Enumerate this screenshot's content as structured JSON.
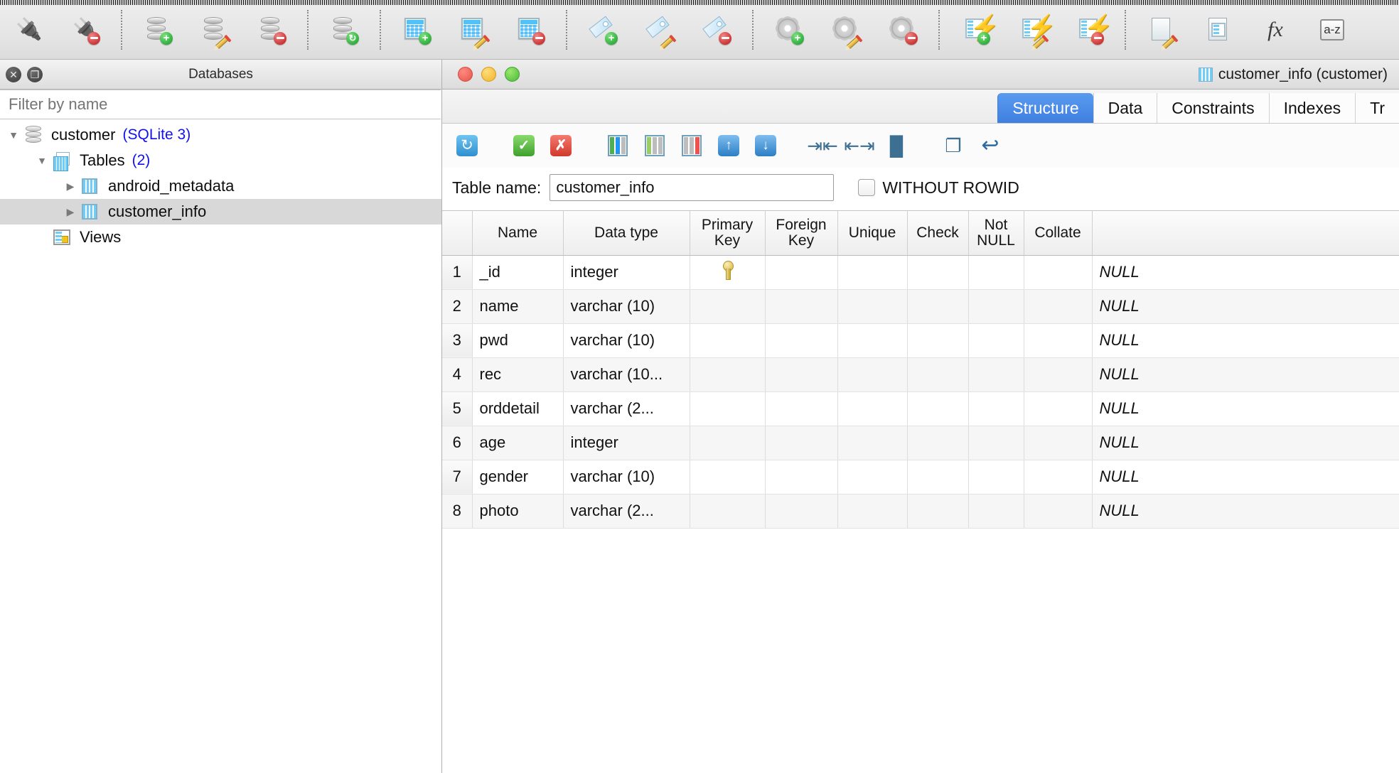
{
  "toolbar": {
    "groups": [
      {
        "name": "connection",
        "items": [
          {
            "name": "connect-database-icon",
            "glyph": "plug"
          },
          {
            "name": "disconnect-database-icon",
            "glyph": "plug-off"
          }
        ]
      },
      {
        "name": "database-crud",
        "items": [
          {
            "name": "add-database-icon",
            "glyph": "db-add"
          },
          {
            "name": "edit-database-icon",
            "glyph": "db-edit"
          },
          {
            "name": "delete-database-icon",
            "glyph": "db-delete"
          }
        ]
      },
      {
        "name": "refresh-group",
        "items": [
          {
            "name": "refresh-database-icon",
            "glyph": "db-refresh"
          }
        ]
      },
      {
        "name": "table-crud",
        "items": [
          {
            "name": "add-table-icon",
            "glyph": "table-add"
          },
          {
            "name": "edit-table-icon",
            "glyph": "table-edit"
          },
          {
            "name": "delete-table-icon",
            "glyph": "table-delete"
          }
        ]
      },
      {
        "name": "index-crud",
        "items": [
          {
            "name": "add-index-icon",
            "glyph": "tag-add"
          },
          {
            "name": "edit-index-icon",
            "glyph": "tag-edit"
          },
          {
            "name": "delete-index-icon",
            "glyph": "tag-delete"
          }
        ]
      },
      {
        "name": "procedure-crud",
        "items": [
          {
            "name": "add-procedure-icon",
            "glyph": "gear-add"
          },
          {
            "name": "edit-procedure-icon",
            "glyph": "gear-edit"
          },
          {
            "name": "delete-procedure-icon",
            "glyph": "gear-delete"
          }
        ]
      },
      {
        "name": "trigger-crud",
        "items": [
          {
            "name": "add-trigger-icon",
            "glyph": "bolt-add"
          },
          {
            "name": "edit-trigger-icon",
            "glyph": "bolt-edit"
          },
          {
            "name": "delete-trigger-icon",
            "glyph": "bolt-delete"
          }
        ]
      },
      {
        "name": "utilities",
        "items": [
          {
            "name": "new-query-icon",
            "glyph": "doc-edit"
          },
          {
            "name": "import-export-icon",
            "glyph": "doc-table"
          },
          {
            "name": "function-builder-icon",
            "glyph": "fx"
          },
          {
            "name": "sort-az-icon",
            "glyph": "az"
          }
        ]
      }
    ],
    "fx_label": "fx",
    "az_label": "a-z"
  },
  "sidebar": {
    "title": "Databases",
    "close_button": "✕",
    "restore_button": "❐",
    "filter": {
      "placeholder": "Filter by name",
      "value": ""
    },
    "tree": [
      {
        "label": "customer",
        "sub": "(SQLite 3)",
        "icon": "database-icon",
        "indent": 0,
        "twisty": "expanded",
        "selected": false
      },
      {
        "label": "Tables",
        "sub": "(2)",
        "icon": "tables-icon",
        "indent": 1,
        "twisty": "expanded",
        "selected": false
      },
      {
        "label": "android_metadata",
        "sub": "",
        "icon": "table-icon",
        "indent": 2,
        "twisty": "collapsed",
        "selected": false
      },
      {
        "label": "customer_info",
        "sub": "",
        "icon": "table-icon",
        "indent": 2,
        "twisty": "collapsed",
        "selected": true
      },
      {
        "label": "Views",
        "sub": "",
        "icon": "views-icon",
        "indent": 1,
        "twisty": "none",
        "selected": false
      }
    ]
  },
  "pane": {
    "title": "customer_info (customer)",
    "window_buttons": [
      "close",
      "minimize",
      "zoom"
    ],
    "tabs": [
      {
        "label": "Structure",
        "active": true
      },
      {
        "label": "Data",
        "active": false
      },
      {
        "label": "Constraints",
        "active": false
      },
      {
        "label": "Indexes",
        "active": false
      },
      {
        "label": "Tr",
        "active": false
      }
    ],
    "structure_toolbar": [
      {
        "name": "refresh-button",
        "glyph": "refresh"
      },
      {
        "name": "apply-button",
        "glyph": "check"
      },
      {
        "name": "discard-button",
        "glyph": "cross"
      },
      {
        "name": "add-field-button",
        "glyph": "col-add"
      },
      {
        "name": "insert-field-button",
        "glyph": "col-insert"
      },
      {
        "name": "delete-field-button",
        "glyph": "col-delete"
      },
      {
        "name": "move-field-up-button",
        "glyph": "arrow-up"
      },
      {
        "name": "move-field-down-button",
        "glyph": "arrow-down"
      },
      {
        "name": "shrink-columns-button",
        "glyph": "shrink"
      },
      {
        "name": "expand-columns-button",
        "glyph": "expand"
      },
      {
        "name": "paint-button",
        "glyph": "paint"
      },
      {
        "name": "copy-button",
        "glyph": "copy"
      },
      {
        "name": "revert-button",
        "glyph": "undo"
      }
    ],
    "table_name": {
      "label": "Table name:",
      "value": "customer_info"
    },
    "without_rowid": {
      "label": "WITHOUT ROWID",
      "checked": false
    }
  },
  "grid": {
    "columns": [
      "",
      "Name",
      "Data type",
      "Primary\nKey",
      "Foreign\nKey",
      "Unique",
      "Check",
      "Not\nNULL",
      "Collate",
      ""
    ],
    "column_labels": [
      {
        "line1": "",
        "line2": ""
      },
      {
        "line1": "Name",
        "line2": ""
      },
      {
        "line1": "Data type",
        "line2": ""
      },
      {
        "line1": "Primary",
        "line2": "Key"
      },
      {
        "line1": "Foreign",
        "line2": "Key"
      },
      {
        "line1": "Unique",
        "line2": ""
      },
      {
        "line1": "Check",
        "line2": ""
      },
      {
        "line1": "Not",
        "line2": "NULL"
      },
      {
        "line1": "Collate",
        "line2": ""
      },
      {
        "line1": "",
        "line2": ""
      }
    ],
    "rows": [
      {
        "num": "1",
        "name": "_id",
        "datatype": "integer",
        "pk": true,
        "fk": "",
        "unique": "",
        "check": "",
        "notnull": "",
        "collate": "",
        "default": "NULL"
      },
      {
        "num": "2",
        "name": "name",
        "datatype": "varchar (10)",
        "pk": false,
        "fk": "",
        "unique": "",
        "check": "",
        "notnull": "",
        "collate": "",
        "default": "NULL"
      },
      {
        "num": "3",
        "name": "pwd",
        "datatype": "varchar (10)",
        "pk": false,
        "fk": "",
        "unique": "",
        "check": "",
        "notnull": "",
        "collate": "",
        "default": "NULL"
      },
      {
        "num": "4",
        "name": "rec",
        "datatype": "varchar (10...",
        "pk": false,
        "fk": "",
        "unique": "",
        "check": "",
        "notnull": "",
        "collate": "",
        "default": "NULL"
      },
      {
        "num": "5",
        "name": "orddetail",
        "datatype": "varchar (2...",
        "pk": false,
        "fk": "",
        "unique": "",
        "check": "",
        "notnull": "",
        "collate": "",
        "default": "NULL"
      },
      {
        "num": "6",
        "name": "age",
        "datatype": "integer",
        "pk": false,
        "fk": "",
        "unique": "",
        "check": "",
        "notnull": "",
        "collate": "",
        "default": "NULL"
      },
      {
        "num": "7",
        "name": "gender",
        "datatype": "varchar (10)",
        "pk": false,
        "fk": "",
        "unique": "",
        "check": "",
        "notnull": "",
        "collate": "",
        "default": "NULL"
      },
      {
        "num": "8",
        "name": "photo",
        "datatype": "varchar (2...",
        "pk": false,
        "fk": "",
        "unique": "",
        "check": "",
        "notnull": "",
        "collate": "",
        "default": "NULL"
      }
    ]
  },
  "colors": {
    "accent_tab": "#3f7fe0",
    "tree_sub": "#1111ee",
    "selected_row": "#d8d8d8",
    "alt_row": "#f6f6f6"
  }
}
